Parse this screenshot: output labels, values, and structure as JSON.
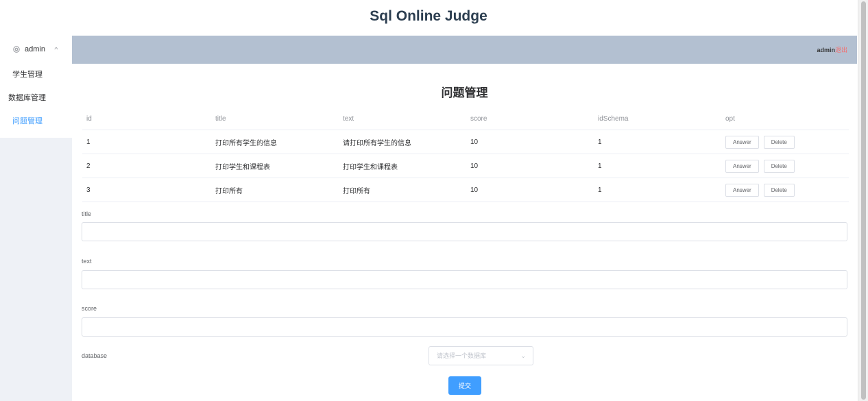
{
  "app": {
    "title": "Sql Online Judge"
  },
  "sidebar": {
    "user": "admin",
    "items": [
      {
        "label": "学生管理"
      },
      {
        "label": "数据库管理"
      },
      {
        "label": "问题管理",
        "active": true
      }
    ]
  },
  "topbar": {
    "user": "admin",
    "logout": "退出"
  },
  "page": {
    "title": "问题管理"
  },
  "table": {
    "headers": [
      "id",
      "title",
      "text",
      "score",
      "idSchema",
      "opt"
    ],
    "rows": [
      {
        "id": "1",
        "title": "打印所有学生的信息",
        "text": "请打印所有学生的信息",
        "score": "10",
        "idSchema": "1"
      },
      {
        "id": "2",
        "title": "打印学生和课程表",
        "text": "打印学生和课程表",
        "score": "10",
        "idSchema": "1"
      },
      {
        "id": "3",
        "title": "打印所有",
        "text": "打印所有",
        "score": "10",
        "idSchema": "1"
      }
    ],
    "answer_label": "Answer",
    "delete_label": "Delete"
  },
  "form": {
    "title_label": "title",
    "title_value": "",
    "text_label": "text",
    "text_value": "",
    "score_label": "score",
    "score_value": "",
    "database_label": "database",
    "database_placeholder": "请选择一个数据库",
    "submit_label": "提交"
  },
  "colors": {
    "accent": "#409eff",
    "header_bg": "#b3c0d1",
    "sidebar_bg": "#eef1f6",
    "logout": "#f56c6c"
  }
}
